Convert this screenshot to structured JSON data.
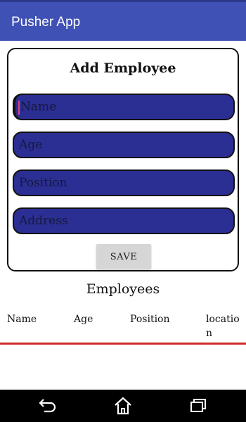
{
  "app_bar": {
    "title": "Pusher App"
  },
  "form": {
    "title": "Add Employee",
    "fields": [
      {
        "placeholder": "Name",
        "value": ""
      },
      {
        "placeholder": "Age",
        "value": ""
      },
      {
        "placeholder": "Position",
        "value": ""
      },
      {
        "placeholder": "Address",
        "value": ""
      }
    ],
    "save_label": "SAVE"
  },
  "employees": {
    "title": "Employees",
    "columns": [
      "Name",
      "Age",
      "Position",
      "location"
    ],
    "rows": []
  },
  "nav_bar": {
    "icons": [
      "back-icon",
      "home-icon",
      "recent-apps-icon"
    ]
  },
  "colors": {
    "app_bar": "#3f51b5",
    "field_fill": "#2b2f93",
    "divider": "#cf2b2b",
    "nav_bar": "#000000"
  }
}
